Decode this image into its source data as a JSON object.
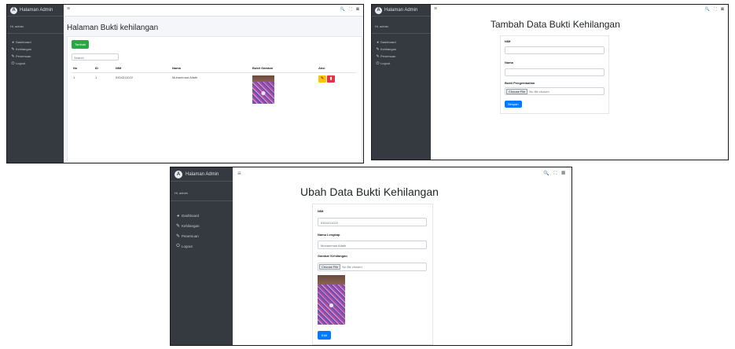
{
  "sidebar": {
    "brand": "Halaman Admin",
    "user": "Hi, admin",
    "items": [
      {
        "label": "Dashboard",
        "icon": "dashboard-icon"
      },
      {
        "label": "Kehilangan",
        "icon": "edit-icon"
      },
      {
        "label": "Penemuan",
        "icon": "edit-icon"
      },
      {
        "label": "Logout",
        "icon": "logout-icon"
      }
    ]
  },
  "topbar": {
    "menu": "≡",
    "tools": "🔍 ⛶ ▦"
  },
  "panel1": {
    "title": "Halaman Bukti kehilangan",
    "add_button": "Tambah",
    "search_placeholder": "Search",
    "columns": [
      "No",
      "ID",
      "NIM",
      "Nama",
      "Bukti Gambar",
      "Aksi"
    ],
    "rows": [
      {
        "no": "1",
        "id": "1",
        "nim": "5304311022",
        "nama": "Muhammad Alfath"
      }
    ]
  },
  "panel2": {
    "title": "Tambah Data Bukti Kehilangan",
    "nim_label": "NIM",
    "nama_label": "Nama",
    "file_label": "Bukti Pengembalian",
    "file_button": "Choose File",
    "file_text": "No file chosen",
    "submit": "Simpan"
  },
  "panel3": {
    "title": "Ubah Data Bukti Kehilangan",
    "nim_label": "NIM",
    "nim_value": "5304311022",
    "nama_label": "Nama Lengkap",
    "nama_value": "Muhammad Alfath",
    "file_label": "Gambar Kehilangan",
    "file_button": "Choose File",
    "file_text": "No file chosen",
    "submit": "Edit"
  },
  "colors": {
    "sidebar": "#343a40",
    "primary": "#007bff",
    "success": "#28a745",
    "warning": "#ffc107",
    "danger": "#dc3545"
  }
}
